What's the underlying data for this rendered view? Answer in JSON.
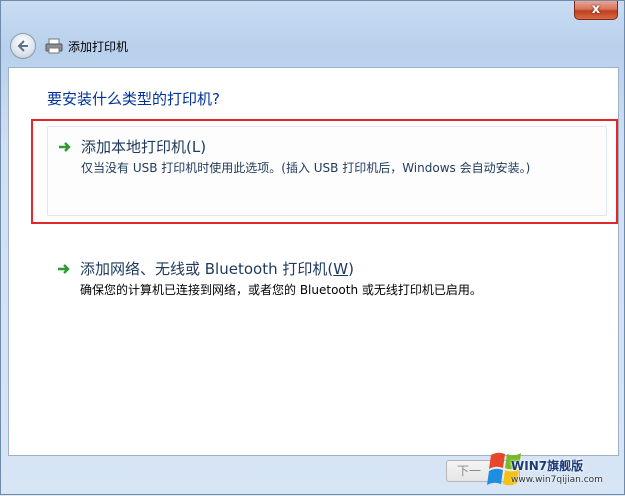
{
  "window": {
    "title": "添加打印机",
    "close_label": "x"
  },
  "main": {
    "question": "要安装什么类型的打印机?",
    "options": [
      {
        "title": "添加本地打印机(L)",
        "description": "仅当没有 USB 打印机时使用此选项。(插入 USB 打印机后，Windows 会自动安装。)"
      },
      {
        "title_prefix": "添加网络、无线或 Bluetooth 打印机(",
        "title_key": "W",
        "title_suffix": ")",
        "description": "确保您的计算机已连接到网络，或者您的 Bluetooth 或无线打印机已启用。"
      }
    ]
  },
  "footer": {
    "next_label": "下一"
  },
  "watermark": {
    "text": "WIN7旗舰版",
    "url": "www.win7qijian.com"
  },
  "icons": {
    "back": "back-arrow-icon",
    "printer": "printer-icon",
    "option_arrow": "green-arrow-icon",
    "windows_logo": "windows-logo-icon"
  },
  "colors": {
    "heading": "#003399",
    "option_text": "#1e395b",
    "highlight": "#e2262a",
    "arrow": "#2f9a2f"
  }
}
